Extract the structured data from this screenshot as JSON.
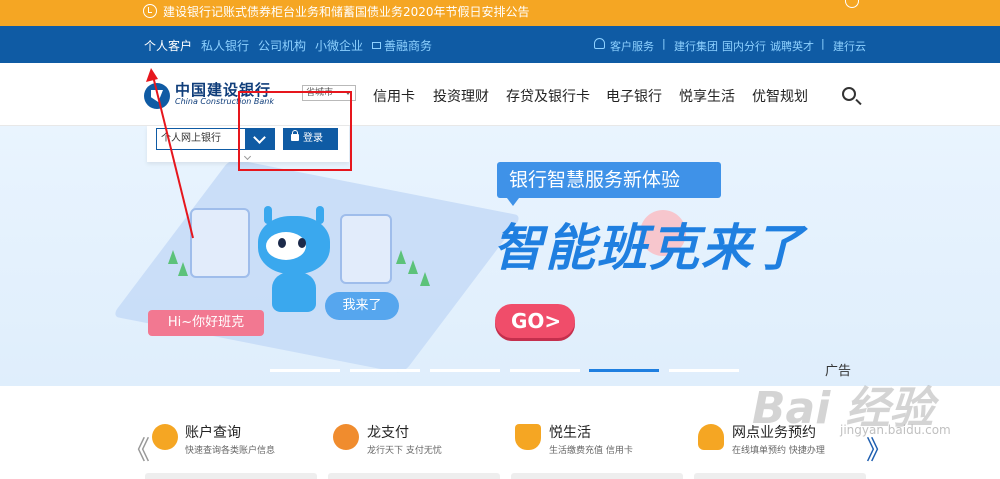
{
  "notice": {
    "text": "建设银行记账式债券柜台业务和储蓄国债业务2020年节假日安排公告"
  },
  "topnav": {
    "left_items": [
      "个人客户",
      "私人银行",
      "公司机构",
      "小微企业",
      "善融商务"
    ],
    "right_items": [
      "客户服务",
      "建行集团",
      "国内分行",
      "诚聘英才",
      "建行云"
    ],
    "separator": "|"
  },
  "header": {
    "logo_cn": "中国建设银行",
    "logo_en": "China Construction Bank",
    "city_select": "省城市",
    "nav": [
      "信用卡",
      "投资理财",
      "存贷及银行卡",
      "电子银行",
      "悦享生活",
      "优智规划"
    ]
  },
  "login": {
    "select_value": "个人网上银行",
    "button_label": "登录"
  },
  "hero": {
    "tagline": "银行智慧服务新体验",
    "headline": "智能班克来了",
    "go_label": "GO>",
    "bubble_hi": "Hi~你好班克",
    "bubble_me": "我来了",
    "ad_label": "广告",
    "active_slide": 5,
    "slide_count": 6
  },
  "services": {
    "prev": "《",
    "next": "》",
    "items": [
      {
        "title": "账户查询",
        "subtitle": "快速查询各类账户信息",
        "icon": "yen-icon"
      },
      {
        "title": "龙支付",
        "subtitle": "龙行天下 支付无忧",
        "icon": "dragon-pay-icon"
      },
      {
        "title": "悦生活",
        "subtitle": "生活缴费充值 信用卡",
        "icon": "coffee-icon"
      },
      {
        "title": "网点业务预约",
        "subtitle": "在线填单预约 快捷办理",
        "icon": "person-icon"
      }
    ]
  },
  "watermark": {
    "main": "Bai 经验",
    "sub": "jingyan.baidu.com"
  },
  "colors": {
    "brand_blue": "#0f5ba4",
    "notice_orange": "#f5a623",
    "annotation_red": "#e6161d"
  }
}
